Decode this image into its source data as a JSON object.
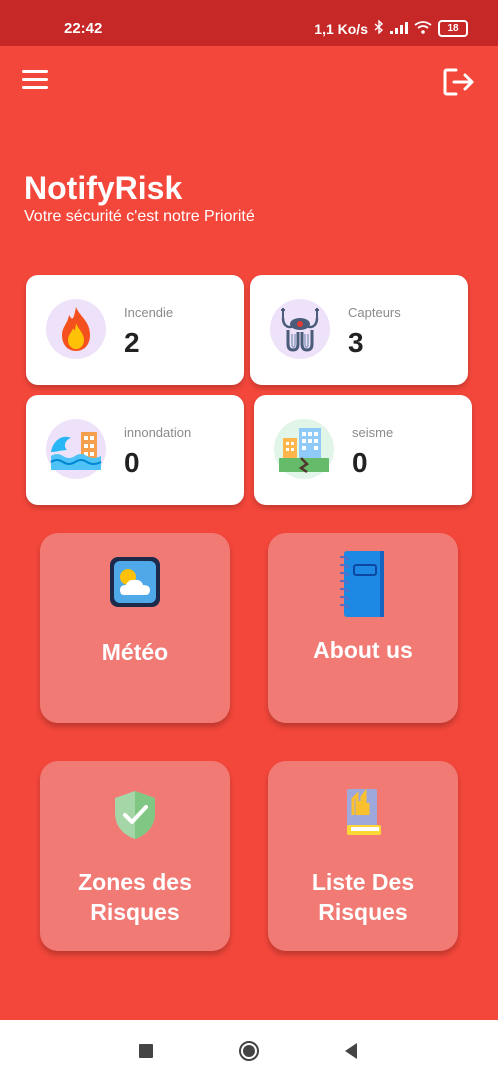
{
  "status_bar": {
    "time": "22:42",
    "network_speed": "1,1 Ko/s",
    "battery": "18",
    "icons": [
      "bluetooth-icon",
      "signal-icon",
      "wifi-icon",
      "battery-icon"
    ]
  },
  "header": {
    "menu_icon": "hamburger-menu-icon",
    "logout_icon": "logout-icon",
    "title": "NotifyRisk",
    "subtitle": "Votre sécurité c'est notre Priorité"
  },
  "stats": [
    {
      "label": "Incendie",
      "value": "2",
      "icon": "fire-icon"
    },
    {
      "label": "Capteurs",
      "value": "3",
      "icon": "sensors-icon"
    },
    {
      "label": "innondation",
      "value": "0",
      "icon": "flood-icon"
    },
    {
      "label": "seisme",
      "value": "0",
      "icon": "earthquake-icon"
    }
  ],
  "tiles": [
    {
      "label": "Météo",
      "icon": "weather-icon"
    },
    {
      "label": "About us",
      "icon": "notebook-icon"
    },
    {
      "label_line1": "Zones des",
      "label_line2": "Risques",
      "icon": "shield-check-icon"
    },
    {
      "label_line1": "Liste Des",
      "label_line2": "Risques",
      "icon": "book-list-icon"
    }
  ],
  "colors": {
    "background": "#F4473B",
    "status_bar": "#C62828",
    "tile": "#F27A75",
    "card": "#FFFFFF"
  },
  "nav_bar": {
    "icons": [
      "recent-apps-icon",
      "home-icon",
      "back-icon"
    ]
  }
}
